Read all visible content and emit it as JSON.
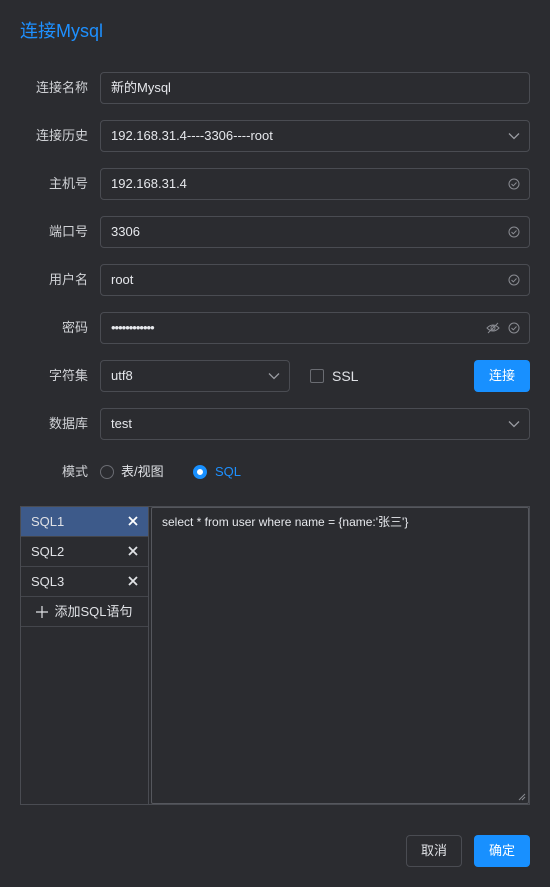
{
  "title": "连接Mysql",
  "form": {
    "conn_name": {
      "label": "连接名称",
      "value": "新的Mysql"
    },
    "history": {
      "label": "连接历史",
      "value": "192.168.31.4----3306----root"
    },
    "host": {
      "label": "主机号",
      "value": "192.168.31.4"
    },
    "port": {
      "label": "端口号",
      "value": "3306"
    },
    "user": {
      "label": "用户名",
      "value": "root"
    },
    "password": {
      "label": "密码",
      "value": "••••••••••••"
    },
    "charset": {
      "label": "字符集",
      "value": "utf8"
    },
    "ssl": {
      "label": "SSL",
      "checked": false
    },
    "connect_button": "连接",
    "database": {
      "label": "数据库",
      "value": "test"
    },
    "mode": {
      "label": "模式",
      "options": [
        {
          "label": "表/视图",
          "checked": false
        },
        {
          "label": "SQL",
          "checked": true
        }
      ]
    }
  },
  "sql": {
    "tabs": [
      {
        "label": "SQL1",
        "active": true
      },
      {
        "label": "SQL2",
        "active": false
      },
      {
        "label": "SQL3",
        "active": false
      }
    ],
    "add_label": "添加SQL语句",
    "editor_text": "select * from user where name = {name:'张三'}"
  },
  "footer": {
    "cancel": "取消",
    "ok": "确定"
  },
  "colors": {
    "accent": "#1890ff",
    "background": "#2b2c30",
    "active_tab": "#3d5a8a"
  }
}
